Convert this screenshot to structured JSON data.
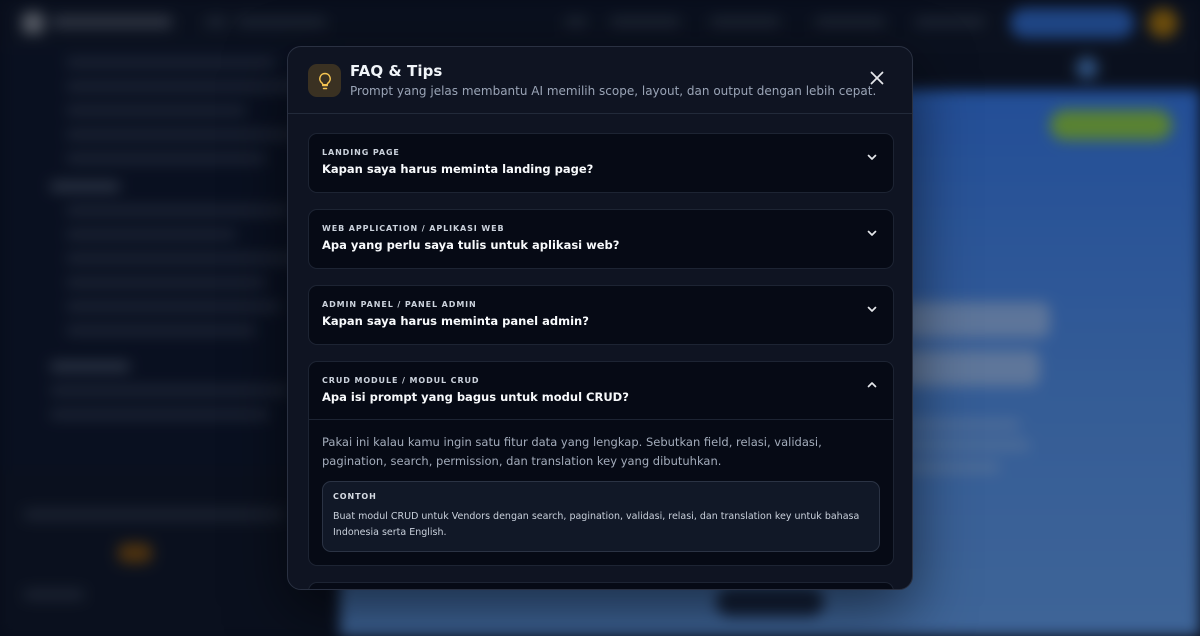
{
  "modal": {
    "icon": "lightbulb-icon",
    "title": "FAQ & Tips",
    "subtitle": "Prompt yang jelas membantu AI memilih scope, layout, dan output dengan lebih cepat.",
    "close_icon": "close-icon"
  },
  "faq": {
    "items": [
      {
        "category": "Landing Page",
        "question": "Kapan saya harus meminta landing page?",
        "expanded": false
      },
      {
        "category": "Web Application / Aplikasi Web",
        "question": "Apa yang perlu saya tulis untuk aplikasi web?",
        "expanded": false
      },
      {
        "category": "Admin Panel / Panel Admin",
        "question": "Kapan saya harus meminta panel admin?",
        "expanded": false
      },
      {
        "category": "CRUD Module / Modul CRUD",
        "question": "Apa isi prompt yang bagus untuk modul CRUD?",
        "expanded": true,
        "answer": "Pakai ini kalau kamu ingin satu fitur data yang lengkap. Sebutkan field, relasi, validasi, pagination, search, permission, dan translation key yang dibutuhkan.",
        "example_label": "CONTOH",
        "example_text": "Buat modul CRUD untuk Vendors dengan search, pagination, validasi, relasi, dan translation key untuk bahasa Indonesia serta English."
      }
    ]
  },
  "colors": {
    "accent_icon": "#f5c451",
    "modal_bg": "#0f1422",
    "card_bg": "#060a15"
  }
}
